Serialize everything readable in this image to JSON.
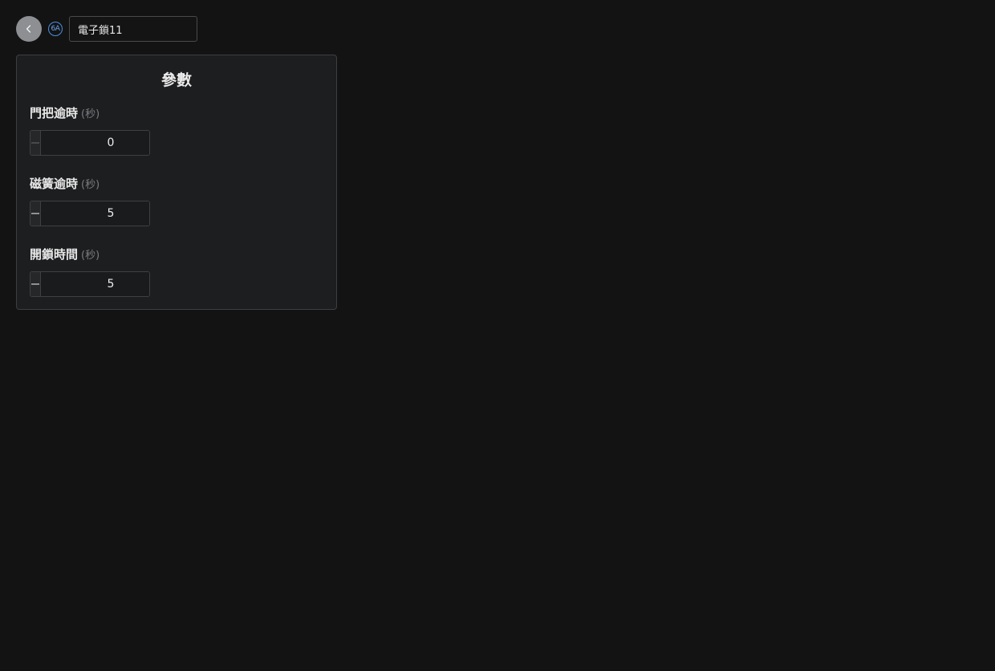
{
  "header": {
    "back_icon": "chevron-left-icon",
    "device_id_badge": "6A",
    "device_name": "電子鎖11"
  },
  "panel": {
    "title": "參數",
    "fields": [
      {
        "label": "門把逾時",
        "unit": "(秒)",
        "value": "0",
        "minus_disabled": true
      },
      {
        "label": "磁簧逾時",
        "unit": "(秒)",
        "value": "5",
        "minus_disabled": false
      },
      {
        "label": "開鎖時間",
        "unit": "(秒)",
        "value": "5",
        "minus_disabled": false
      }
    ]
  },
  "colors": {
    "background": "#131313",
    "panel": "#1d1e20",
    "accent_badge": "#4a8fe0"
  }
}
